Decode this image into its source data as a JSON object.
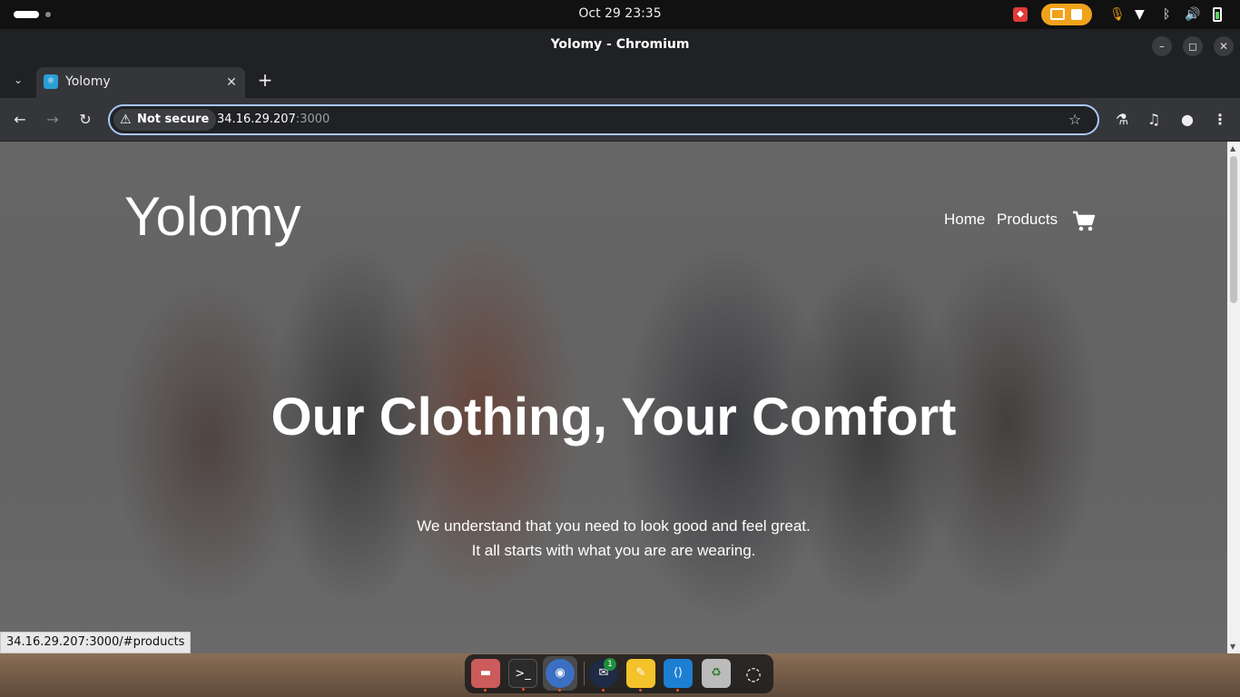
{
  "system": {
    "clock": "Oct 29  23:35"
  },
  "window": {
    "title": "Yolomy - Chromium",
    "minimize": "–",
    "maximize": "◻",
    "close": "✕"
  },
  "tab": {
    "title": "Yolomy",
    "close": "✕",
    "new_tab": "+"
  },
  "toolbar": {
    "security_label": "Not secure",
    "url_host": "34.16.29.207",
    "url_port": ":3000"
  },
  "page": {
    "brand": "Yolomy",
    "nav": {
      "home": "Home",
      "products": "Products"
    },
    "hero_heading": "Our Clothing, Your Comfort",
    "hero_line1": "We understand that you need to look good and feel great.",
    "hero_line2": "It all starts with what you are are wearing."
  },
  "status_bar": {
    "hover_url": "34.16.29.207:3000/#products"
  },
  "dock": {
    "thunderbird_badge": "1"
  },
  "colors": {
    "omnibox_focus": "#a8c7fa",
    "accent_orange": "#f0a21a",
    "ubuntu_dot": "#e95420"
  }
}
